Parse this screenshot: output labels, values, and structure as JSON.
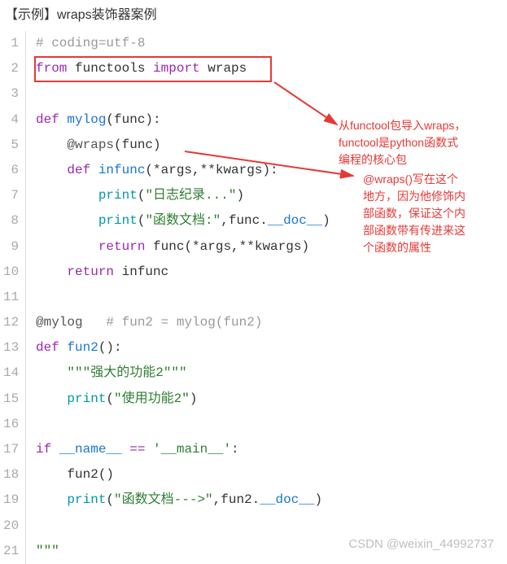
{
  "title": "【示例】wraps装饰器案例",
  "code": {
    "lines": [
      {
        "num": "1",
        "tokens": [
          {
            "t": "# coding=utf-8",
            "c": "cm-comment"
          }
        ]
      },
      {
        "num": "2",
        "tokens": [
          {
            "t": "from ",
            "c": "cm-keyword"
          },
          {
            "t": "functools ",
            "c": "cm-var"
          },
          {
            "t": "import ",
            "c": "cm-keyword"
          },
          {
            "t": "wraps",
            "c": "cm-var"
          }
        ]
      },
      {
        "num": "3",
        "tokens": [
          {
            "t": "",
            "c": ""
          }
        ]
      },
      {
        "num": "4",
        "tokens": [
          {
            "t": "def ",
            "c": "cm-keyword"
          },
          {
            "t": "mylog",
            "c": "cm-def"
          },
          {
            "t": "(func):",
            "c": "cm-var"
          }
        ]
      },
      {
        "num": "5",
        "tokens": [
          {
            "t": "    ",
            "c": ""
          },
          {
            "t": "@wraps",
            "c": "cm-decorator"
          },
          {
            "t": "(func)",
            "c": "cm-var"
          }
        ]
      },
      {
        "num": "6",
        "tokens": [
          {
            "t": "    ",
            "c": ""
          },
          {
            "t": "def ",
            "c": "cm-keyword"
          },
          {
            "t": "infunc",
            "c": "cm-def"
          },
          {
            "t": "(*args,**kwargs):",
            "c": "cm-var"
          }
        ]
      },
      {
        "num": "7",
        "tokens": [
          {
            "t": "        ",
            "c": ""
          },
          {
            "t": "print",
            "c": "cm-builtin"
          },
          {
            "t": "(",
            "c": "cm-var"
          },
          {
            "t": "\"日志纪录...\"",
            "c": "cm-string"
          },
          {
            "t": ")",
            "c": "cm-var"
          }
        ]
      },
      {
        "num": "8",
        "tokens": [
          {
            "t": "        ",
            "c": ""
          },
          {
            "t": "print",
            "c": "cm-builtin"
          },
          {
            "t": "(",
            "c": "cm-var"
          },
          {
            "t": "\"函数文档:\"",
            "c": "cm-string"
          },
          {
            "t": ",func.",
            "c": "cm-var"
          },
          {
            "t": "__doc__",
            "c": "cm-dunder"
          },
          {
            "t": ")",
            "c": "cm-var"
          }
        ]
      },
      {
        "num": "9",
        "tokens": [
          {
            "t": "        ",
            "c": ""
          },
          {
            "t": "return ",
            "c": "cm-keyword"
          },
          {
            "t": "func(*args,**kwargs)",
            "c": "cm-var"
          }
        ]
      },
      {
        "num": "10",
        "tokens": [
          {
            "t": "    ",
            "c": ""
          },
          {
            "t": "return ",
            "c": "cm-keyword"
          },
          {
            "t": "infunc",
            "c": "cm-var"
          }
        ]
      },
      {
        "num": "11",
        "tokens": [
          {
            "t": "",
            "c": ""
          }
        ]
      },
      {
        "num": "12",
        "tokens": [
          {
            "t": "@mylog",
            "c": "cm-decorator"
          },
          {
            "t": "   ",
            "c": ""
          },
          {
            "t": "# fun2 = mylog(fun2)",
            "c": "cm-comment"
          }
        ]
      },
      {
        "num": "13",
        "tokens": [
          {
            "t": "def ",
            "c": "cm-keyword"
          },
          {
            "t": "fun2",
            "c": "cm-def"
          },
          {
            "t": "():",
            "c": "cm-var"
          }
        ]
      },
      {
        "num": "14",
        "tokens": [
          {
            "t": "    ",
            "c": ""
          },
          {
            "t": "\"\"\"强大的功能2\"\"\"",
            "c": "cm-string"
          }
        ]
      },
      {
        "num": "15",
        "tokens": [
          {
            "t": "    ",
            "c": ""
          },
          {
            "t": "print",
            "c": "cm-builtin"
          },
          {
            "t": "(",
            "c": "cm-var"
          },
          {
            "t": "\"使用功能2\"",
            "c": "cm-string"
          },
          {
            "t": ")",
            "c": "cm-var"
          }
        ]
      },
      {
        "num": "16",
        "tokens": [
          {
            "t": "",
            "c": ""
          }
        ]
      },
      {
        "num": "17",
        "tokens": [
          {
            "t": "if ",
            "c": "cm-keyword"
          },
          {
            "t": "__name__",
            "c": "cm-dunder"
          },
          {
            "t": " == ",
            "c": "cm-operator"
          },
          {
            "t": "'__main__'",
            "c": "cm-string"
          },
          {
            "t": ":",
            "c": "cm-var"
          }
        ]
      },
      {
        "num": "18",
        "tokens": [
          {
            "t": "    ",
            "c": ""
          },
          {
            "t": "fun2()",
            "c": "cm-var"
          }
        ]
      },
      {
        "num": "19",
        "tokens": [
          {
            "t": "    ",
            "c": ""
          },
          {
            "t": "print",
            "c": "cm-builtin"
          },
          {
            "t": "(",
            "c": "cm-var"
          },
          {
            "t": "\"函数文档--->\"",
            "c": "cm-string"
          },
          {
            "t": ",fun2.",
            "c": "cm-var"
          },
          {
            "t": "__doc__",
            "c": "cm-dunder"
          },
          {
            "t": ")",
            "c": "cm-var"
          }
        ]
      },
      {
        "num": "20",
        "tokens": [
          {
            "t": "",
            "c": ""
          }
        ]
      },
      {
        "num": "21",
        "tokens": [
          {
            "t": "\"\"\"",
            "c": "cm-string"
          }
        ]
      }
    ]
  },
  "annotations": {
    "note1_l1": "从functool包导入wraps，",
    "note1_l2": "functool是python函数式",
    "note1_l3": "编程的核心包",
    "note2_l1": "@wraps()写在这个",
    "note2_l2": "地方，因为他修饰内",
    "note2_l3": "部函数，保证这个内",
    "note2_l4": "部函数带有传进来这",
    "note2_l5": "个函数的属性"
  },
  "watermark": "CSDN @weixin_44992737"
}
